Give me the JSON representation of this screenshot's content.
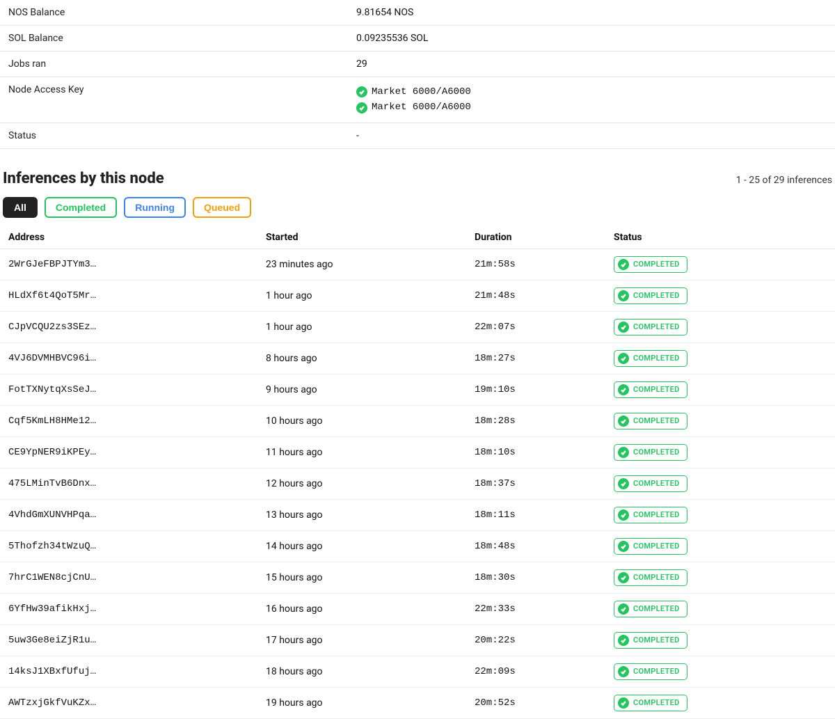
{
  "info": {
    "rows": [
      {
        "label": "NOS Balance",
        "value": "9.81654 NOS"
      },
      {
        "label": "SOL Balance",
        "value": "0.09235536 SOL"
      },
      {
        "label": "Jobs ran",
        "value": "29"
      }
    ],
    "accessKeyLabel": "Node Access Key",
    "accessKeys": [
      "Market 6000/A6000",
      "Market 6000/A6000"
    ],
    "statusLabel": "Status",
    "statusValue": "-"
  },
  "section": {
    "title": "Inferences by this node",
    "count": "1 - 25 of 29 inferences"
  },
  "tabs": {
    "all": "All",
    "completed": "Completed",
    "running": "Running",
    "queued": "Queued"
  },
  "columns": {
    "address": "Address",
    "started": "Started",
    "duration": "Duration",
    "status": "Status"
  },
  "statusBadge": "COMPLETED",
  "inferences": [
    {
      "address": "2WrGJeFBPJTYm3…",
      "started": "23 minutes ago",
      "duration": "21m:58s",
      "status": "COMPLETED"
    },
    {
      "address": "HLdXf6t4QoT5Mr…",
      "started": "1 hour ago",
      "duration": "21m:48s",
      "status": "COMPLETED"
    },
    {
      "address": "CJpVCQU2zs3SEz…",
      "started": "1 hour ago",
      "duration": "22m:07s",
      "status": "COMPLETED"
    },
    {
      "address": "4VJ6DVMHBVC96i…",
      "started": "8 hours ago",
      "duration": "18m:27s",
      "status": "COMPLETED"
    },
    {
      "address": "FotTXNytqXsSeJ…",
      "started": "9 hours ago",
      "duration": "19m:10s",
      "status": "COMPLETED"
    },
    {
      "address": "Cqf5KmLH8HMe12…",
      "started": "10 hours ago",
      "duration": "18m:28s",
      "status": "COMPLETED"
    },
    {
      "address": "CE9YpNER9iKPEy…",
      "started": "11 hours ago",
      "duration": "18m:10s",
      "status": "COMPLETED"
    },
    {
      "address": "475LMinTvB6Dnx…",
      "started": "12 hours ago",
      "duration": "18m:37s",
      "status": "COMPLETED"
    },
    {
      "address": "4VhdGmXUNVHPqa…",
      "started": "13 hours ago",
      "duration": "18m:11s",
      "status": "COMPLETED"
    },
    {
      "address": "5Thofzh34tWzuQ…",
      "started": "14 hours ago",
      "duration": "18m:48s",
      "status": "COMPLETED"
    },
    {
      "address": "7hrC1WEN8cjCnU…",
      "started": "15 hours ago",
      "duration": "18m:30s",
      "status": "COMPLETED"
    },
    {
      "address": "6YfHw39afikHxj…",
      "started": "16 hours ago",
      "duration": "22m:33s",
      "status": "COMPLETED"
    },
    {
      "address": "5uw3Ge8eiZjR1u…",
      "started": "17 hours ago",
      "duration": "20m:22s",
      "status": "COMPLETED"
    },
    {
      "address": "14ksJ1XBxfUfuj…",
      "started": "18 hours ago",
      "duration": "22m:09s",
      "status": "COMPLETED"
    },
    {
      "address": "AWTzxjGkfVuKZx…",
      "started": "19 hours ago",
      "duration": "20m:52s",
      "status": "COMPLETED"
    }
  ]
}
